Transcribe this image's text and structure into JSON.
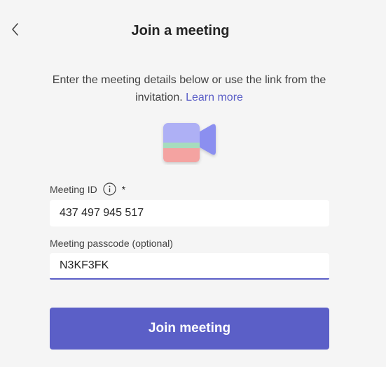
{
  "header": {
    "back_icon": "chevron-left-icon",
    "title": "Join a meeting"
  },
  "description": {
    "text": "Enter the meeting details below or use the link from the invitation.",
    "link_label": "Learn more"
  },
  "illustration": {
    "icon": "video-camera-icon"
  },
  "form": {
    "meeting_id": {
      "label": "Meeting ID",
      "info_icon": "info-icon",
      "required_mark": "*",
      "value": "437 497 945 517"
    },
    "passcode": {
      "label": "Meeting passcode (optional)",
      "value": "N3KF3FK"
    },
    "join_label": "Join meeting"
  },
  "colors": {
    "accent": "#5b5fc7",
    "background": "#f5f5f5",
    "input_background": "#ffffff"
  }
}
